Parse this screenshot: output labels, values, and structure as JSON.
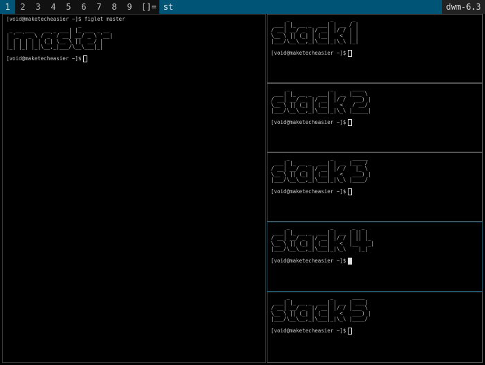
{
  "bar": {
    "tags": [
      "1",
      "2",
      "3",
      "4",
      "5",
      "6",
      "7",
      "8",
      "9"
    ],
    "layout": "[]=",
    "title": "st",
    "status": "dwm-6.3"
  },
  "master": {
    "command_line": "[void@maketecheasier ~]$ figlet master",
    "art": "                       _            \n _ __ ___   __ _ ___| |_ ___ _ __ \n| '_ ` _ \\ / _` / __| __/ _ \\ '__|\n| | | | | | (_| \\__ \\ ||  __/ |   \n|_| |_| |_|\\__,_|___/\\__\\___|_|   ",
    "prompt": "[void@maketecheasier ~]$"
  },
  "stacks": [
    {
      "art": "     _             _      _ \n ___| |_ __ _  ___| | __ / |\n/ __| __/ _` |/ __| |/ / | |\n\\__ \\ || (_| | (__|   <  | |\n|___/\\__\\__,_|\\___|_|\\_\\ |_|",
      "prompt": "[void@maketecheasier ~]$"
    },
    {
      "art": "     _             _      ____  \n ___| |_ __ _  ___| | __ |___ \\ \n/ __| __/ _` |/ __| |/ /   __) |\n\\__ \\ || (_| | (__|   <   / __/ \n|___/\\__\\__,_|\\___|_|\\_\\ |_____|",
      "prompt": "[void@maketecheasier ~]$"
    },
    {
      "art": "     _             _      _____ \n ___| |_ __ _  ___| | __ |___ / \n/ __| __/ _` |/ __| |/ /   |_ \\ \n\\__ \\ || (_| | (__|   <   ___) |\n|___/\\__\\__,_|\\___|_|\\_\\ |____/ ",
      "prompt": "[void@maketecheasier ~]$"
    },
    {
      "art": "     _             _      _  _   \n ___| |_ __ _  ___| | __ | || |  \n/ __| __/ _` |/ __| |/ / | || |_ \n\\__ \\ || (_| | (__|   <  |__   _|\n|___/\\__\\__,_|\\___|_|\\_\\    |_|  ",
      "prompt": "[void@maketecheasier ~]$"
    },
    {
      "art": "     _             _      ____  \n ___| |_ __ _  ___| | __ | ___| \n/ __| __/ _` |/ __| |/ / |___ \\ \n\\__ \\ || (_| | (__|   <   ___) |\n|___/\\__\\__,_|\\___|_|\\_\\ |____/ ",
      "prompt": "[void@maketecheasier ~]$"
    }
  ]
}
